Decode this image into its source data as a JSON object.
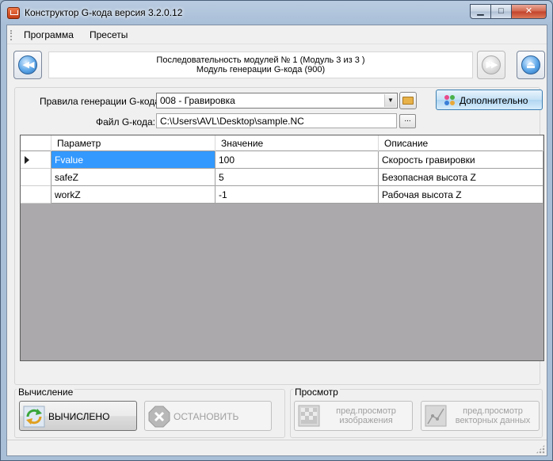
{
  "window": {
    "title": "Конструктор G-кода версия 3.2.0.12",
    "min_glyph": "▁",
    "max_glyph": "□",
    "close_glyph": "✕"
  },
  "menu": [
    {
      "label": "Программа"
    },
    {
      "label": "Пресеты"
    }
  ],
  "navigation": {
    "back_glyph": "◀◀",
    "forward_glyph": "▶▶",
    "eject_glyph": "⏏",
    "sequence_line1": "Последовательность модулей № 1 (Модуль 3 из 3 )",
    "sequence_line2": "Модуль генерации G-кода (900)"
  },
  "form": {
    "rules_label": "Правила генерации G-кода:",
    "rules_value": "008 - Гравировка",
    "file_label": "Файл G-кода:",
    "file_value": "C:\\Users\\AVL\\Desktop\\sample.NC",
    "browse_label": "...",
    "advanced_label": "Дополнительно"
  },
  "grid": {
    "columns": [
      "Параметр",
      "Значение",
      "Описание"
    ],
    "rows": [
      {
        "param": "Fvalue",
        "value": "100",
        "desc": "Скорость гравировки",
        "selected": true
      },
      {
        "param": "safeZ",
        "value": "5",
        "desc": "Безопасная высота Z",
        "selected": false
      },
      {
        "param": "workZ",
        "value": "-1",
        "desc": "Рабочая высота Z",
        "selected": false
      }
    ]
  },
  "calc": {
    "group_title": "Вычисление",
    "compute_label": "ВЫЧИСЛЕНО",
    "stop_label": "ОСТАНОВИТЬ"
  },
  "preview": {
    "group_title": "Просмотр",
    "image_line1": "пред.просмотр",
    "image_line2": "изображения",
    "vector_line1": "пред.просмотр",
    "vector_line2": "векторных данных"
  },
  "colors": {
    "selection": "#3399ff",
    "grid_background": "#aba9ab",
    "advanced_button": "#c4e1f6"
  }
}
